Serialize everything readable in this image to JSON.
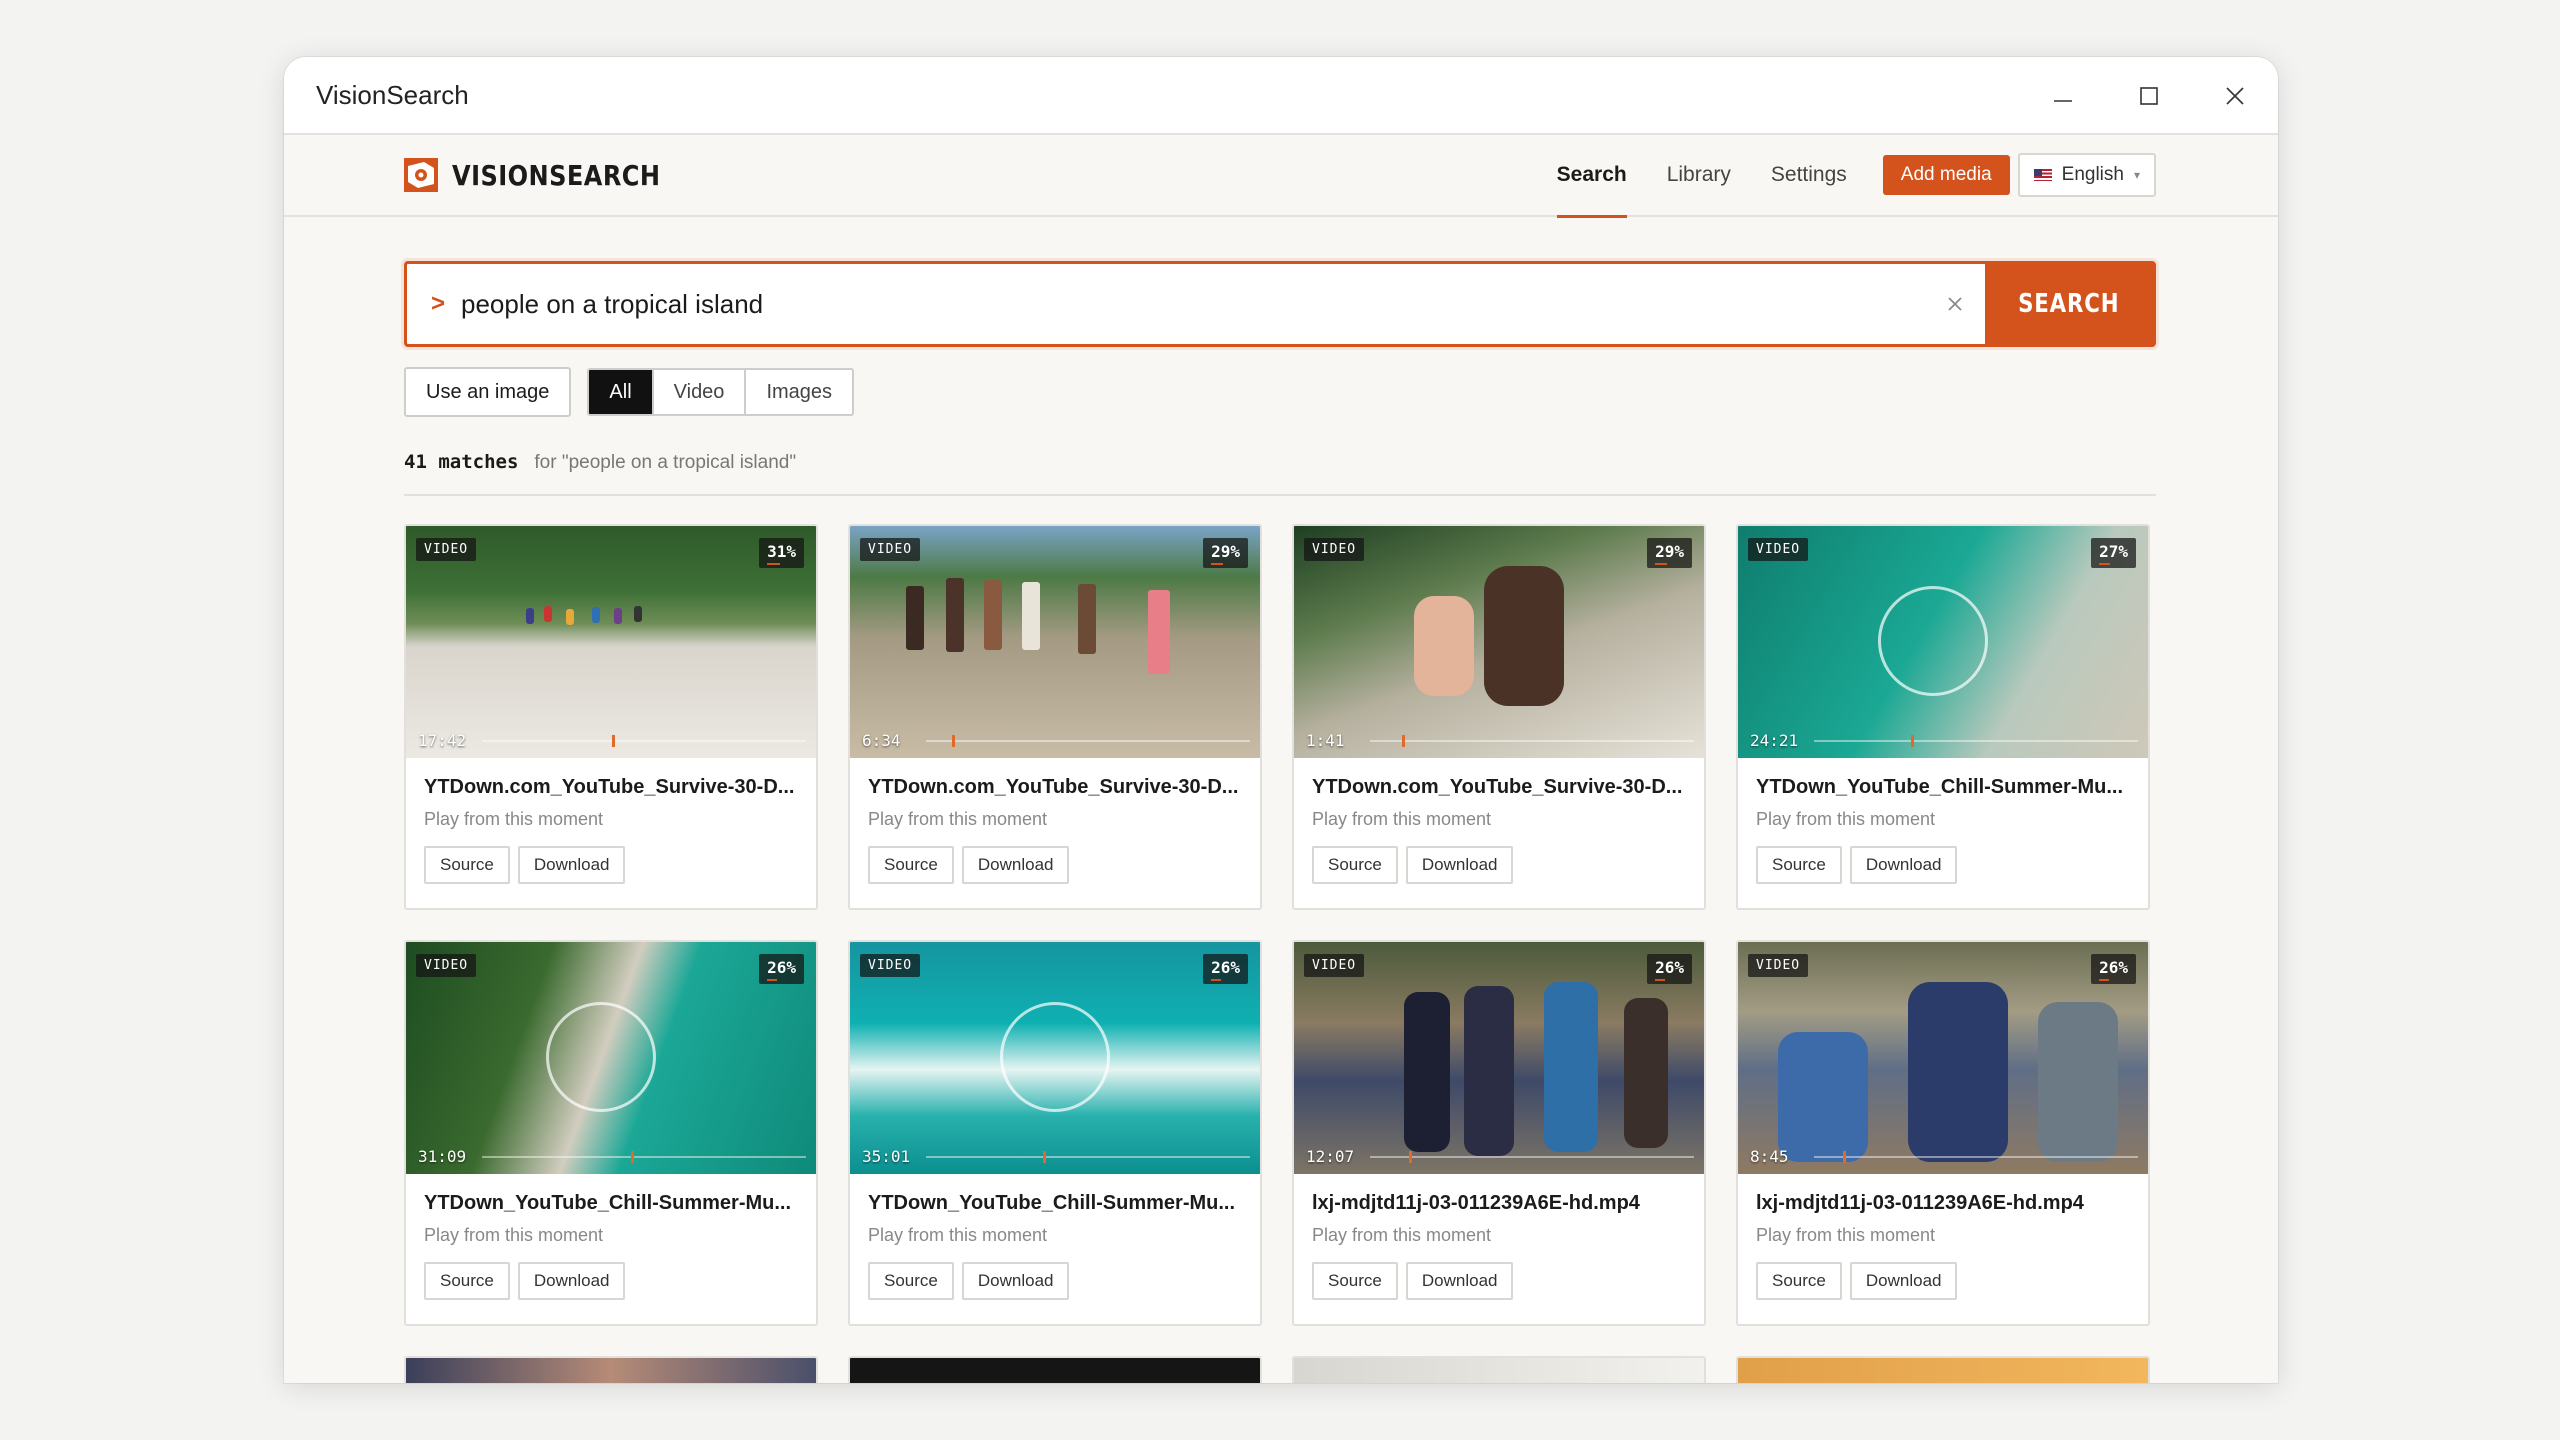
{
  "window": {
    "title": "VisionSearch"
  },
  "nav": {
    "brand": "VISIONSEARCH",
    "links": [
      "Search",
      "Library",
      "Settings"
    ],
    "add_media": "Add media",
    "language": "English"
  },
  "search": {
    "prompt": ">",
    "query": "people on a tropical island",
    "button": "SEARCH"
  },
  "filters": {
    "use_image": "Use an image",
    "types": [
      "All",
      "Video",
      "Images"
    ],
    "selected": "All"
  },
  "results": {
    "count": "41 matches",
    "for_text": "for \"people on a tropical island\""
  },
  "card_labels": {
    "sub": "Play from this moment",
    "source": "Source",
    "download": "Download",
    "badge": "VIDEO"
  },
  "cards": [
    {
      "title": "YTDown.com_YouTube_Survive-30-D...",
      "score": "31%",
      "score_value": 31,
      "duration": "17:42",
      "moment": 0.4
    },
    {
      "title": "YTDown.com_YouTube_Survive-30-D...",
      "score": "29%",
      "score_value": 29,
      "duration": "6:34",
      "moment": 0.08
    },
    {
      "title": "YTDown.com_YouTube_Survive-30-D...",
      "score": "29%",
      "score_value": 29,
      "duration": "1:41",
      "moment": 0.1
    },
    {
      "title": "YTDown_YouTube_Chill-Summer-Mu...",
      "score": "27%",
      "score_value": 27,
      "duration": "24:21",
      "moment": 0.3
    },
    {
      "title": "YTDown_YouTube_Chill-Summer-Mu...",
      "score": "26%",
      "score_value": 26,
      "duration": "31:09",
      "moment": 0.46
    },
    {
      "title": "YTDown_YouTube_Chill-Summer-Mu...",
      "score": "26%",
      "score_value": 26,
      "duration": "35:01",
      "moment": 0.36
    },
    {
      "title": "lxj-mdjtd11j-03-011239A6E-hd.mp4",
      "score": "26%",
      "score_value": 26,
      "duration": "12:07",
      "moment": 0.12
    },
    {
      "title": "lxj-mdjtd11j-03-011239A6E-hd.mp4",
      "score": "26%",
      "score_value": 26,
      "duration": "8:45",
      "moment": 0.09
    }
  ],
  "colors": {
    "accent": "#d4531c",
    "dark": "#111111"
  }
}
